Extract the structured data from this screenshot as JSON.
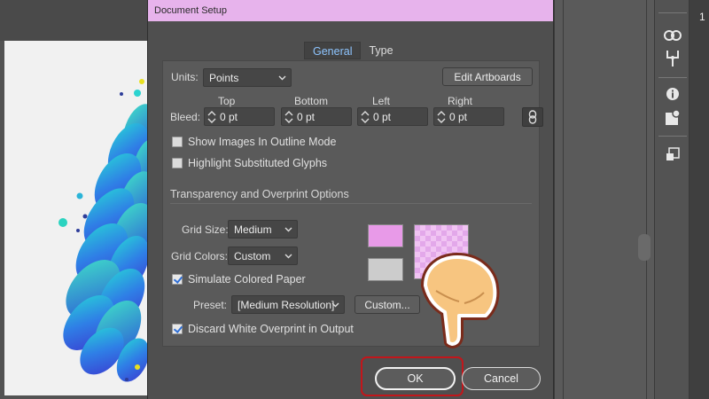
{
  "dialog": {
    "title": "Document Setup",
    "tabs": [
      {
        "label": "General",
        "active": true
      },
      {
        "label": "Type",
        "active": false
      }
    ]
  },
  "units": {
    "label": "Units:",
    "value": "Points"
  },
  "edit_artboards_label": "Edit Artboards",
  "bleed": {
    "label": "Bleed:",
    "top": {
      "label": "Top",
      "value": "0 pt"
    },
    "bottom": {
      "label": "Bottom",
      "value": "0 pt"
    },
    "left": {
      "label": "Left",
      "value": "0 pt"
    },
    "right": {
      "label": "Right",
      "value": "0 pt"
    }
  },
  "checkboxes": {
    "show_images_outline": {
      "label": "Show Images In Outline Mode",
      "checked": false
    },
    "highlight_glyphs": {
      "label": "Highlight Substituted Glyphs",
      "checked": false
    },
    "simulate_paper": {
      "label": "Simulate Colored Paper",
      "checked": true
    },
    "discard_white": {
      "label": "Discard White Overprint in Output",
      "checked": true
    }
  },
  "transparency": {
    "section_title": "Transparency and Overprint Options",
    "grid_size": {
      "label": "Grid Size:",
      "value": "Medium"
    },
    "grid_colors": {
      "label": "Grid Colors:",
      "value": "Custom"
    },
    "preset": {
      "label": "Preset:",
      "value": "[Medium Resolution]"
    },
    "custom_button": "Custom...",
    "swatch_colors": {
      "grid_color_1": "#e89ae8",
      "grid_color_2": "#cccccc"
    }
  },
  "buttons": {
    "ok": "OK",
    "cancel": "Cancel"
  },
  "right_edge_number": "1",
  "colors": {
    "title_bar": "#e7b3ec",
    "tab_active_text": "#8ec5ff",
    "highlight_ring": "#c2161b"
  },
  "icons": [
    "link-icon",
    "puppet-warp-icon",
    "info-icon",
    "place-image-icon",
    "artboard-icon",
    "chain-link-icon",
    "pointing-hand-icon"
  ]
}
